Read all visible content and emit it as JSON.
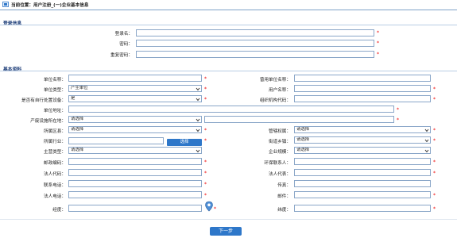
{
  "header": {
    "location_text": "当前位置：用户注册_(一)企业基本信息"
  },
  "sections": {
    "login": "登录信息",
    "basic": "基本资料"
  },
  "login": {
    "username_label": "登录名：",
    "password_label": "密码：",
    "repeat_password_label": "重复密码："
  },
  "basic": {
    "unit_name_label": "单位名称：",
    "former_name_label": "曾用单位名称：",
    "unit_type_label": "单位类型：",
    "unit_type_value": "产生单位",
    "user_name_label": "用户名称：",
    "self_facility_label": "是否有自行处置设备：",
    "self_facility_value": "是",
    "org_code_label": "组织机构代码：",
    "address_label": "单位地址：",
    "waste_location_label": "产废设施所在地：",
    "waste_location_value": "请选择",
    "belong_area_label": "所属区县：",
    "belong_area_value": "请选择",
    "jurisdiction_label": "管辖权属：",
    "jurisdiction_value": "请选择",
    "industry_label": "所属行业：",
    "industry_button": "选择",
    "street_label": "街道乡镇：",
    "street_value": "请选择",
    "main_type_label": "主营类型：",
    "main_type_value": "请选择",
    "scale_label": "企业规模：",
    "scale_value": "请选择",
    "postcode_label": "邮政编码：",
    "env_contact_label": "环保联系人：",
    "legal_code_label": "法人代码：",
    "legal_rep_label": "法人代表：",
    "contact_phone_label": "联系电话：",
    "fax_label": "传真：",
    "legal_phone_label": "法人电话：",
    "email_label": "邮件：",
    "longitude_label": "经度：",
    "latitude_label": "纬度："
  },
  "footer": {
    "next_button": "下一步"
  },
  "colors": {
    "accent": "#2e77c9",
    "required": "#e00000",
    "section_text": "#1f3f7a",
    "border": "#8aa6c8"
  }
}
